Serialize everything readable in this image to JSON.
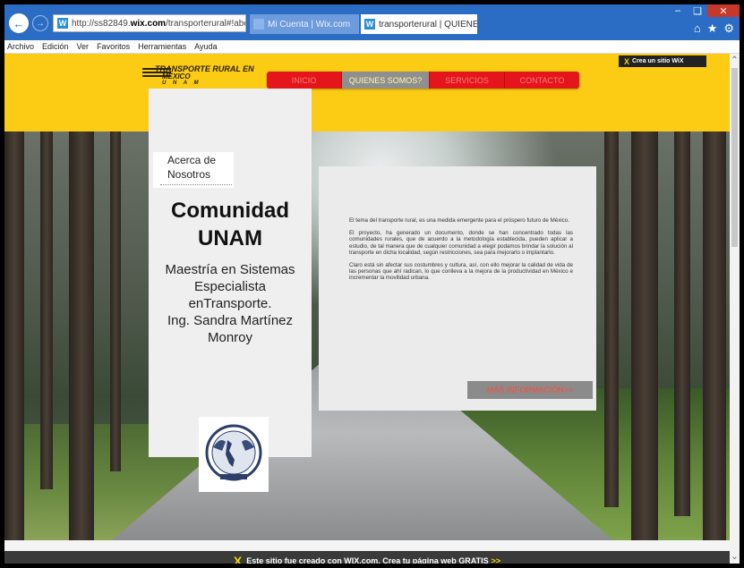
{
  "browser": {
    "url_prefix": "http://ss82849.",
    "url_host": "wix.com",
    "url_rest": "/transporterural#!about/c",
    "tabs": [
      {
        "label": "Mi Cuenta | Wix.com"
      },
      {
        "label": "transporterural | QUIENES S..."
      }
    ],
    "menu": [
      "Archivo",
      "Edición",
      "Ver",
      "Favoritos",
      "Herramientas",
      "Ayuda"
    ]
  },
  "site": {
    "logo": {
      "line1": "TRANSPORTE RURAL EN",
      "line2": "MÉXICO",
      "line3": "U N A M"
    },
    "nav": [
      "INICIO",
      "QUIENES SOMOS?",
      "SERVICIOS",
      "CONTACTO"
    ],
    "nav_active_index": 1,
    "wix_badge": "Crea un sitio WiX",
    "about_tab": [
      "Acerca de",
      "Nosotros"
    ],
    "community_title": [
      "Comunidad",
      "UNAM"
    ],
    "community_sub": [
      "Maestría en Sistemas",
      "Especialista",
      "enTransporte.",
      "Ing. Sandra Martínez",
      "Monroy"
    ],
    "paragraphs": [
      "El tema del transporte rural, es una medida emergente para el próspero futuro de México.",
      "El proyecto, ha generado un documento, donde se han concentrado todas las comunidades rurales, que de acuerdo a la metodología establecida, pueden aplicar a estudio, de tal manera que de cualquier comunidad a elegir podamos brindar la solución al transporte en dicha localidad, según restricciones, sea para mejorarlo o implantarlo.",
      "Claro está sin afectar sus costumbres y cultura, así, con ello mejorar la calidad de vida de las personas que ahí radican, lo que conlleva a la mejora de la productividad en México e incrementar la movilidad urbana."
    ],
    "more_button": "MÁS INFORMACIÓN>>",
    "footer_text": "Este sitio fue creado con WIX.com. Crea tu página web GRATIS",
    "footer_arrow": ">>"
  }
}
